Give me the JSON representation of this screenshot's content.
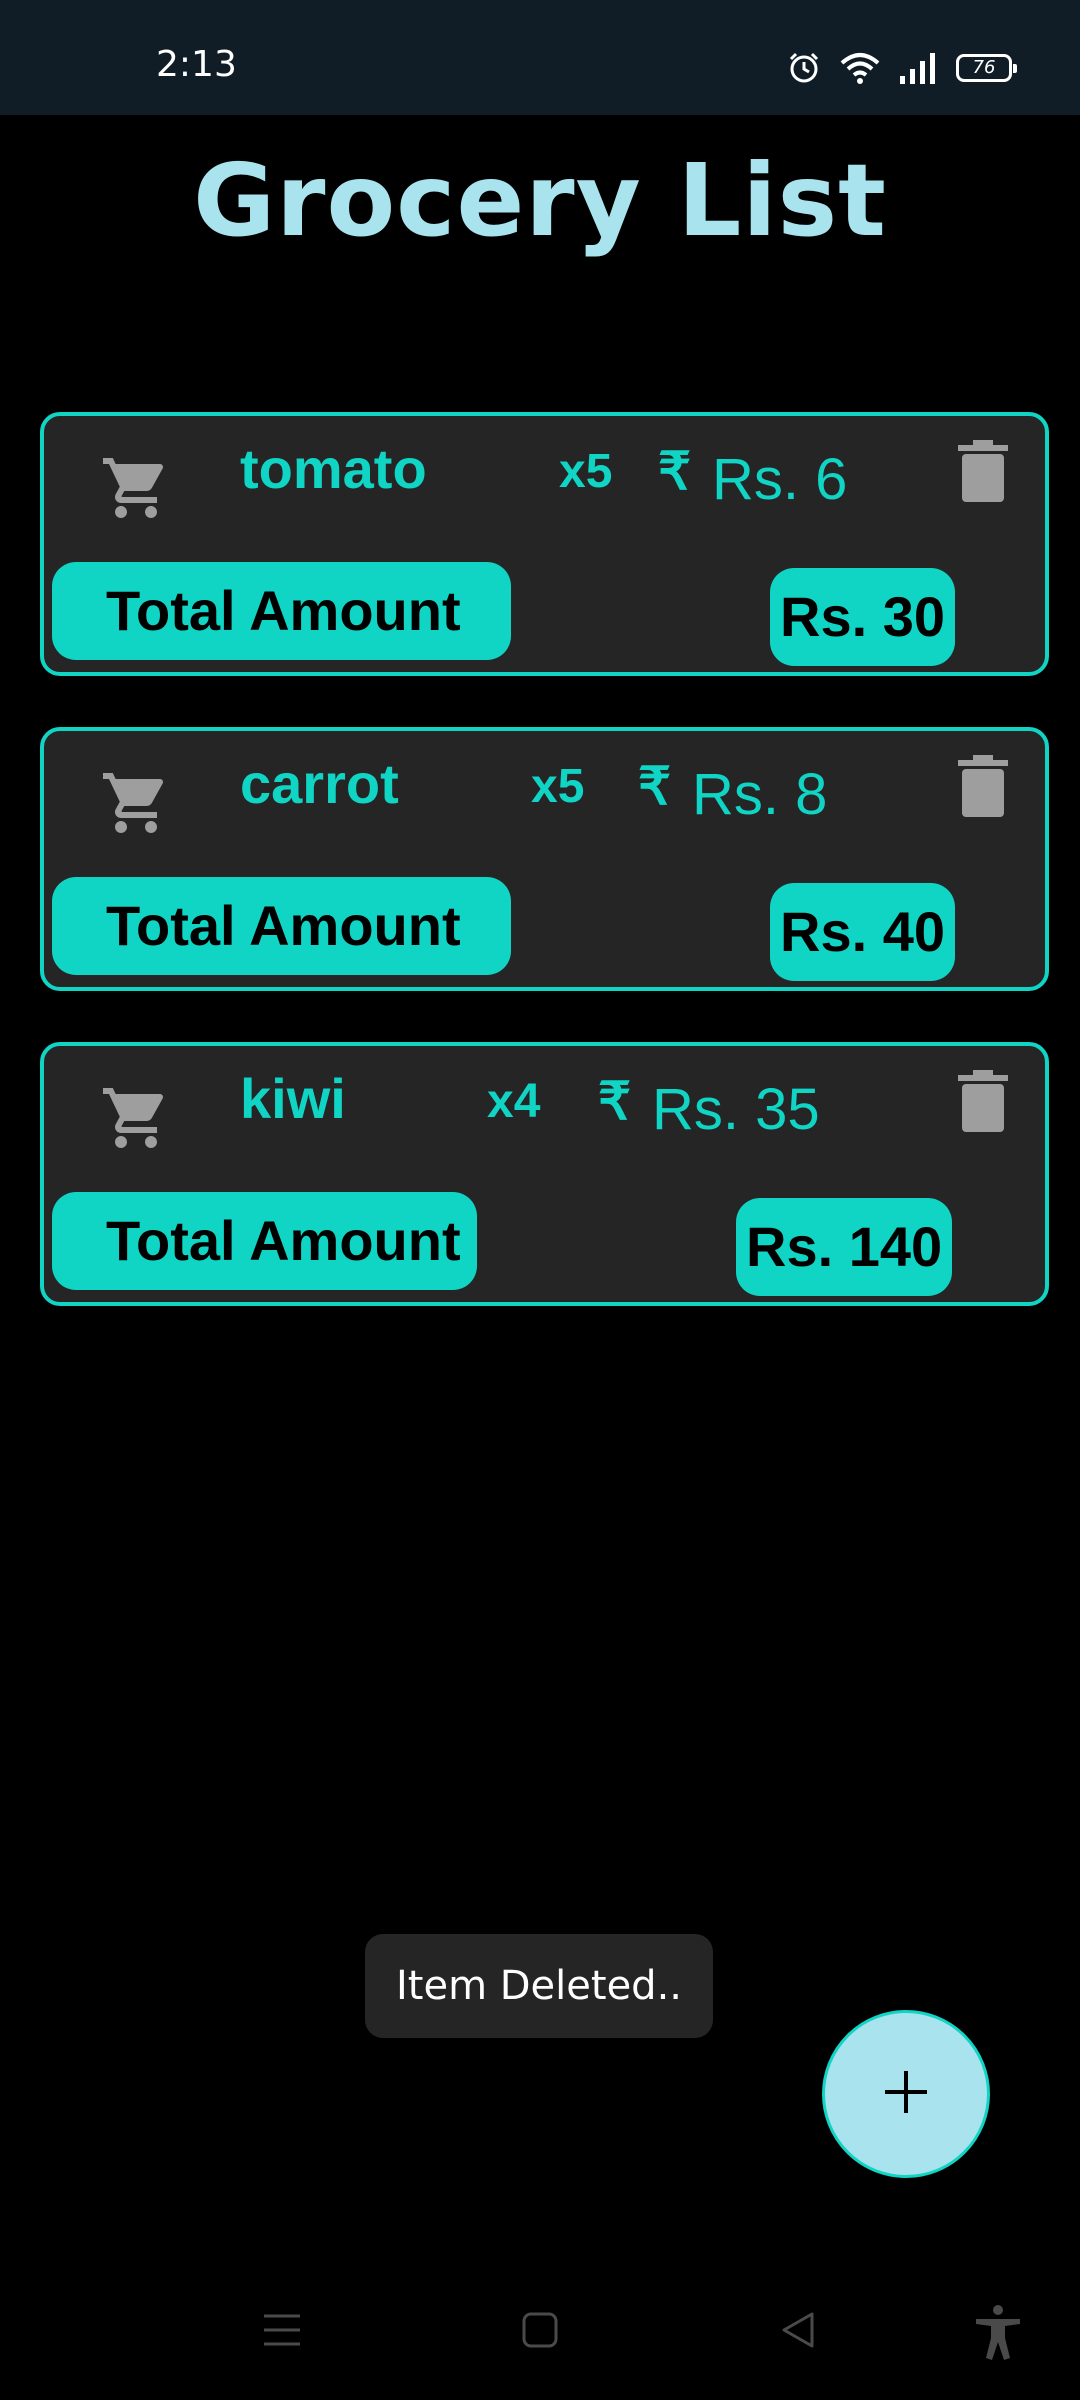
{
  "status_bar": {
    "time": "2:13",
    "battery": "76",
    "icons": [
      "alarm-icon",
      "wifi-icon",
      "signal-icon",
      "battery-icon"
    ]
  },
  "title": "Grocery List",
  "items": [
    {
      "name": "tomato",
      "qty": "x5",
      "rupee": "₹",
      "price": "Rs. 6",
      "total_label": "Total Amount",
      "total": "Rs. 30"
    },
    {
      "name": "carrot",
      "qty": "x5",
      "rupee": "₹",
      "price": "Rs. 8",
      "total_label": "Total Amount",
      "total": "Rs. 40"
    },
    {
      "name": "kiwi",
      "qty": "x4",
      "rupee": "₹",
      "price": "Rs. 35",
      "total_label": "Total Amount",
      "total": "Rs. 140"
    }
  ],
  "toast": "Item Deleted..",
  "fab": {
    "icon": "plus-icon"
  },
  "nav_bar": {
    "icons": [
      "menu-icon",
      "home-icon",
      "back-icon",
      "accessibility-icon"
    ]
  },
  "colors": {
    "accent": "#10d4c4",
    "title": "#a8e3ee",
    "card": "#252525",
    "background": "#000000",
    "status_bar": "#101d26",
    "icon_gray": "#9e9e9e"
  }
}
